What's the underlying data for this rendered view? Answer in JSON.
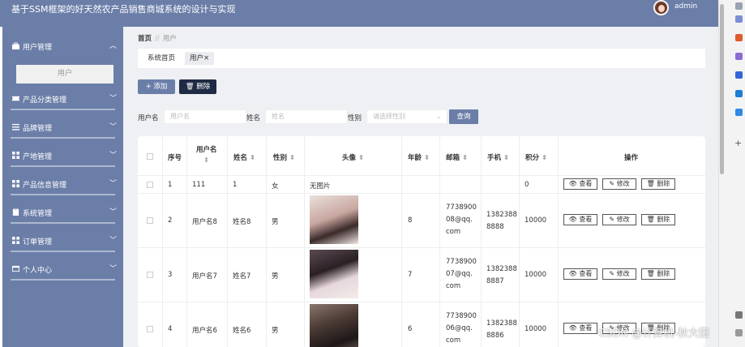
{
  "app": {
    "title": "基于SSM框架的好天然农产品销售商城系统的设计与实现",
    "user": "admin"
  },
  "sidebar": {
    "items": [
      {
        "label": "用户管理",
        "icon": "briefcase-icon"
      },
      {
        "label": "产品分类管理",
        "icon": "ticket-icon"
      },
      {
        "label": "品牌管理",
        "icon": "sliders-icon"
      },
      {
        "label": "产地管理",
        "icon": "grid-icon"
      },
      {
        "label": "产品信息管理",
        "icon": "grid-icon"
      },
      {
        "label": "系统管理",
        "icon": "clipboard-icon"
      },
      {
        "label": "订单管理",
        "icon": "grid-icon"
      },
      {
        "label": "个人中心",
        "icon": "id-card-icon"
      }
    ],
    "sub_item": "用户"
  },
  "breadcrumb": {
    "home": "首页",
    "separator": "//",
    "current": "用户"
  },
  "tabs": {
    "home": "系统首页",
    "active": "用户",
    "close": "×"
  },
  "toolbar": {
    "add": "+ 添加",
    "delete": "删除"
  },
  "search": {
    "username_label": "用户名",
    "username_placeholder": "用户名",
    "name_label": "姓名",
    "name_placeholder": "姓名",
    "gender_label": "性别",
    "gender_placeholder": "请选择性别",
    "button": "查询"
  },
  "table": {
    "headers": {
      "index": "序号",
      "username_line1": "用户名",
      "name": "姓名",
      "gender": "性别",
      "avatar": "头像",
      "age": "年龄",
      "email": "邮箱",
      "phone": "手机",
      "points": "积分",
      "actions": "操作"
    },
    "actions": {
      "view": "查看",
      "edit": "修改",
      "delete": "删除"
    },
    "rows": [
      {
        "index": "1",
        "username": "111",
        "name": "1",
        "gender": "女",
        "avatar": "无图片",
        "age": "",
        "email": [
          "",
          "",
          ""
        ],
        "phone": [
          "",
          ""
        ],
        "points": "0"
      },
      {
        "index": "2",
        "username": "用户名8",
        "name": "姓名8",
        "gender": "男",
        "avatar": "",
        "age": "8",
        "email": [
          "7738900",
          "08@qq.",
          "com"
        ],
        "phone": [
          "1382388",
          "8888"
        ],
        "points": "10000"
      },
      {
        "index": "3",
        "username": "用户名7",
        "name": "姓名7",
        "gender": "男",
        "avatar": "",
        "age": "7",
        "email": [
          "7738900",
          "07@qq.",
          "com"
        ],
        "phone": [
          "1382388",
          "8887"
        ],
        "points": "10000"
      },
      {
        "index": "4",
        "username": "用户名6",
        "name": "姓名6",
        "gender": "男",
        "avatar": "",
        "age": "6",
        "email": [
          "7738900",
          "06@qq.",
          "com"
        ],
        "phone": [
          "1382388",
          "8886"
        ],
        "points": "10000"
      }
    ]
  },
  "watermark": "CSDN @计算机-秋大田",
  "colors": {
    "primary": "#6b7ea8",
    "dark_button": "#1f2a44"
  }
}
